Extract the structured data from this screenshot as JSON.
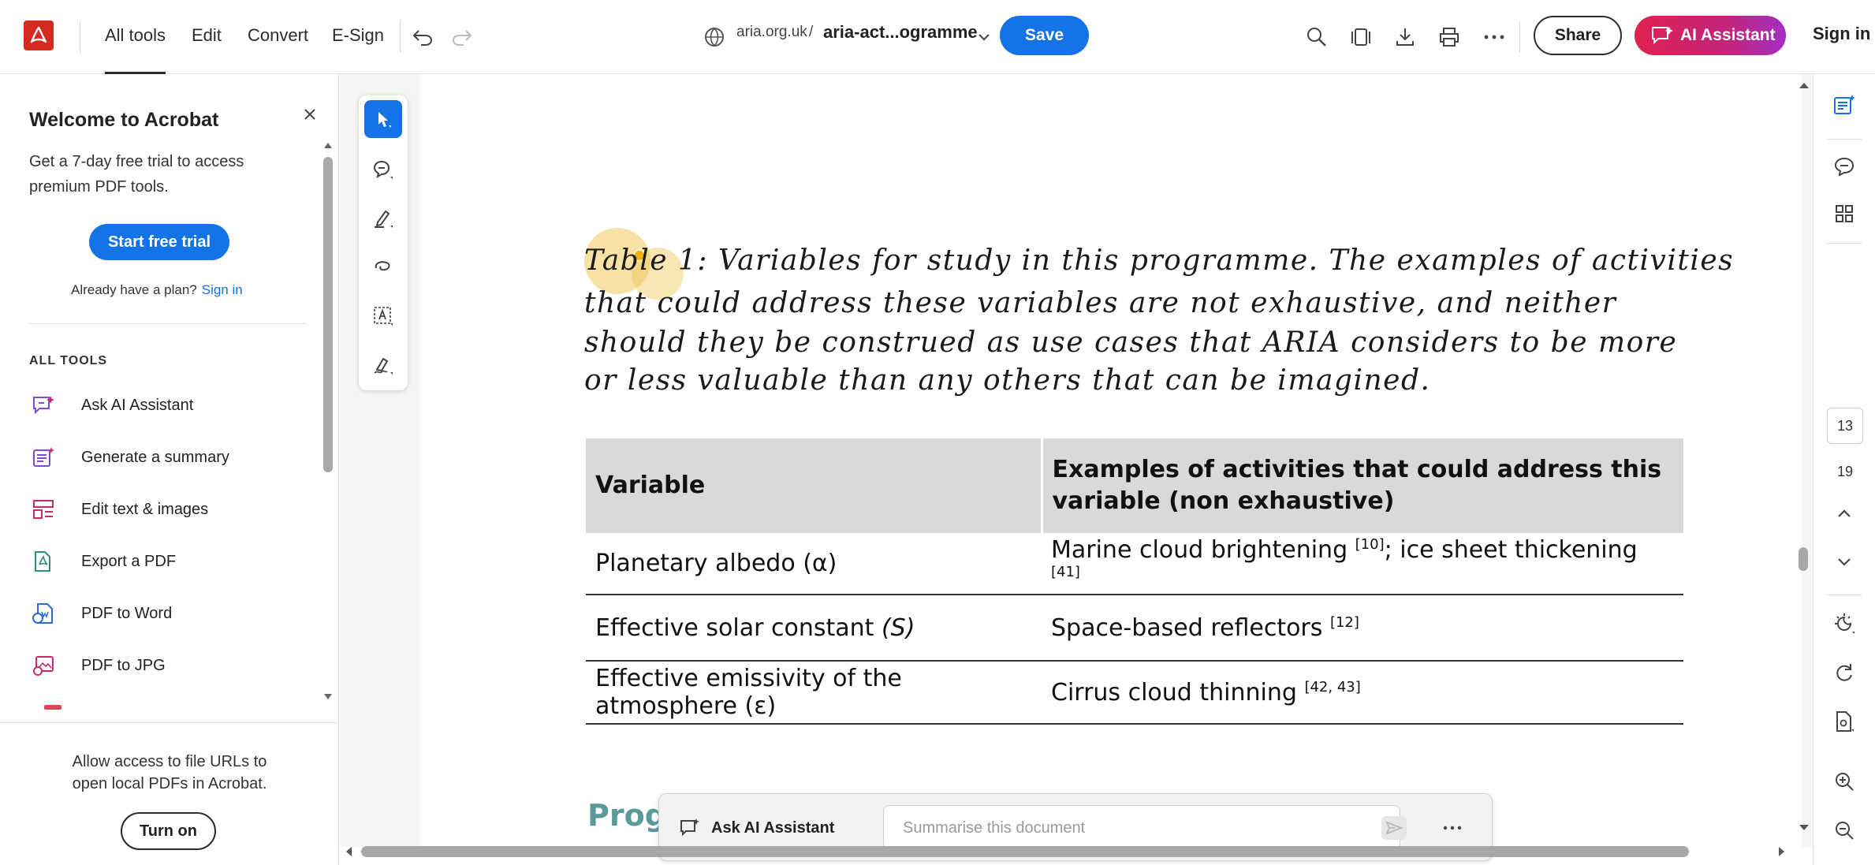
{
  "topbar": {
    "nav": [
      "All tools",
      "Edit",
      "Convert",
      "E-Sign"
    ],
    "breadcrumb_domain": "aria.org.uk",
    "breadcrumb_sep": "/",
    "doc_title": "aria-act...ogramme",
    "save": "Save",
    "share": "Share",
    "ai_assistant": "AI Assistant",
    "sign_in": "Sign in"
  },
  "left_panel": {
    "title": "Welcome to Acrobat",
    "description": "Get a 7-day free trial to access premium PDF tools.",
    "trial_button": "Start free trial",
    "plan_text": "Already have a plan?",
    "plan_link": "Sign in",
    "section_label": "ALL TOOLS",
    "tools": [
      {
        "label": "Ask AI Assistant",
        "icon": "ai-chat-icon"
      },
      {
        "label": "Generate a summary",
        "icon": "summary-icon"
      },
      {
        "label": "Edit text & images",
        "icon": "edit-text-icon"
      },
      {
        "label": "Export a PDF",
        "icon": "export-pdf-icon"
      },
      {
        "label": "PDF to Word",
        "icon": "pdf-to-word-icon"
      },
      {
        "label": "PDF to JPG",
        "icon": "pdf-to-jpg-icon"
      }
    ],
    "access_text": "Allow access to file URLs to open local PDFs in Acrobat.",
    "turn_on": "Turn on"
  },
  "document": {
    "caption_lines": [
      "Table 1: Variables for study in this programme. The examples of activities",
      "that could address these variables are not exhaustive, and neither",
      "should they be construed as use cases that ARIA considers to be more",
      "or less valuable than any others that can be imagined."
    ],
    "table": {
      "headers": [
        "Variable",
        "Examples of activities that could address this variable (non exhaustive)"
      ],
      "rows": [
        {
          "variable": "Planetary albedo (α)",
          "examples": "Marine cloud brightening ",
          "ref1": "[10]",
          "examples2": "; ice sheet thickening ",
          "ref2": "[41]"
        },
        {
          "variable": "Effective solar constant ",
          "var_sym": "(S)",
          "examples": "Space-based reflectors ",
          "ref1": "[12]"
        },
        {
          "variable": "Effective emissivity of the atmosphere (ε)",
          "examples": "Cirrus cloud thinning ",
          "ref1": "[42, 43]"
        }
      ]
    },
    "next_heading": "Progr"
  },
  "ai_bar": {
    "label": "Ask AI Assistant",
    "placeholder": "Summarise this document"
  },
  "right_rail": {
    "current_page": "13",
    "total_pages": "19"
  },
  "colors": {
    "accent": "#1473e6",
    "brand": "#d7291f",
    "ai_gradient_start": "#e0224f",
    "ai_gradient_end": "#a32fc2",
    "heading_teal": "#5b9a98",
    "table_header": "#d9d9d9"
  }
}
